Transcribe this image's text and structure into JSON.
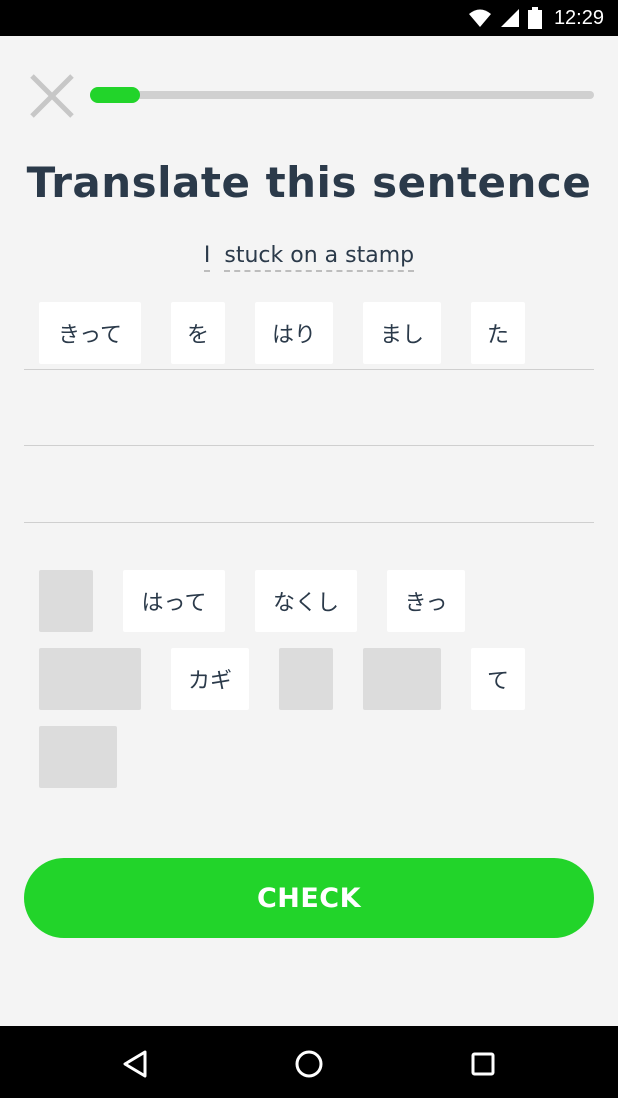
{
  "status_bar": {
    "time": "12:29",
    "icons": [
      "wifi-icon",
      "signal-icon",
      "battery-icon"
    ]
  },
  "lesson": {
    "progress_fraction": 0.1,
    "title": "Translate this sentence",
    "prompt_words": [
      "I",
      "stuck on a stamp"
    ]
  },
  "answer_tiles": [
    "きって",
    "を",
    "はり",
    "まし",
    "た"
  ],
  "word_bank": [
    {
      "label": "",
      "used": true
    },
    {
      "label": "はって",
      "used": false
    },
    {
      "label": "なくし",
      "used": false
    },
    {
      "label": "きっ",
      "used": false
    },
    {
      "label": "",
      "used": true
    },
    {
      "label": "カギ",
      "used": false
    },
    {
      "label": "",
      "used": true
    },
    {
      "label": "",
      "used": true
    },
    {
      "label": "て",
      "used": false
    },
    {
      "label": "",
      "used": true
    }
  ],
  "check_button": {
    "label": "CHECK"
  },
  "nav_bar": {
    "icons": [
      "back-icon",
      "home-icon",
      "recents-icon"
    ]
  },
  "colors": {
    "accent": "#22d42a",
    "text": "#2b3a4a",
    "background": "#f4f4f4"
  }
}
